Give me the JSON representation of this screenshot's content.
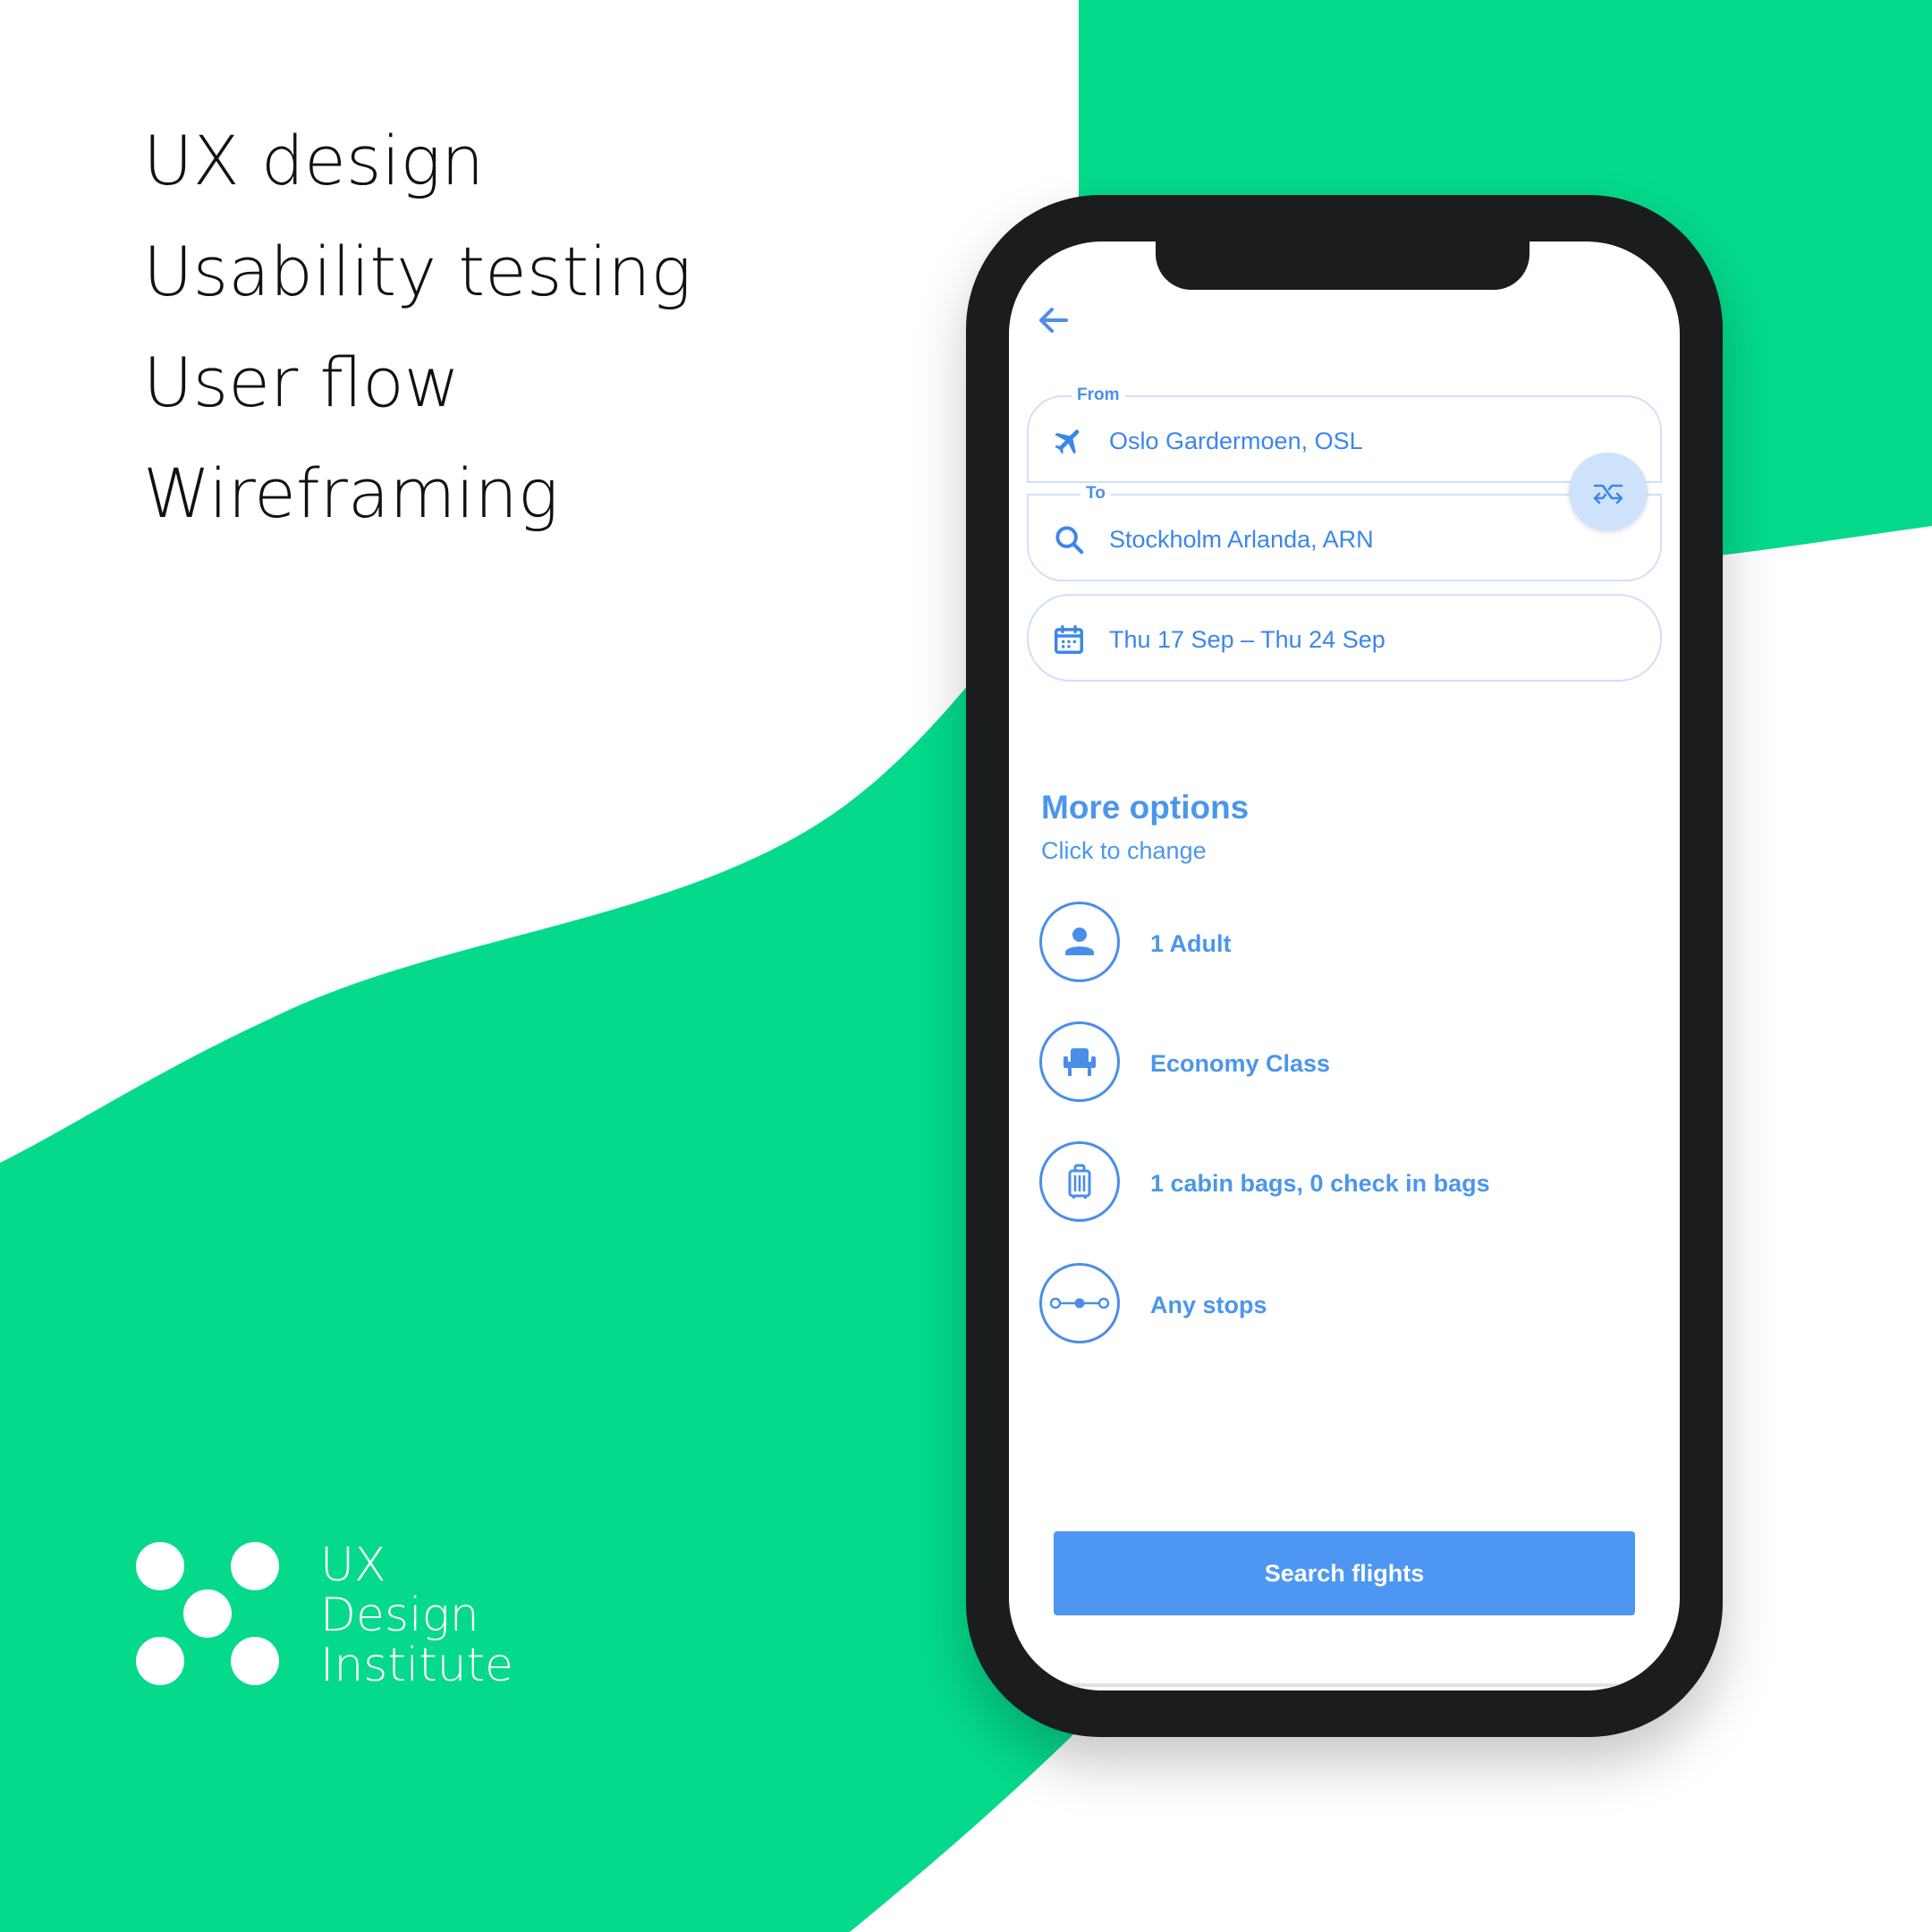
{
  "skills": [
    "UX design",
    "Usability testing",
    "User flow",
    "Wireframing"
  ],
  "brand": {
    "line1": "UX",
    "line2": "Design",
    "line3": "Institute"
  },
  "colors": {
    "green": "#04d98c",
    "blue": "#4b96ec",
    "frame": "#1a1c1d"
  },
  "app": {
    "back_icon": "arrow-left-icon",
    "from": {
      "label": "From",
      "value": "Oslo Gardermoen, OSL",
      "icon": "airplane-icon"
    },
    "to": {
      "label": "To",
      "value": "Stockholm Arlanda, ARN",
      "icon": "search-icon"
    },
    "swap_icon": "swap-icon",
    "dates": {
      "value": "Thu 17 Sep – Thu 24 Sep",
      "icon": "calendar-icon"
    },
    "more_options": {
      "title": "More options",
      "subtitle": "Click to change",
      "items": [
        {
          "label": "1 Adult",
          "icon": "person-icon"
        },
        {
          "label": "Economy Class",
          "icon": "seat-icon"
        },
        {
          "label": "1 cabin bags, 0 check in bags",
          "icon": "luggage-icon"
        },
        {
          "label": "Any stops",
          "icon": "stops-icon"
        }
      ]
    },
    "search_button": "Search flights"
  }
}
